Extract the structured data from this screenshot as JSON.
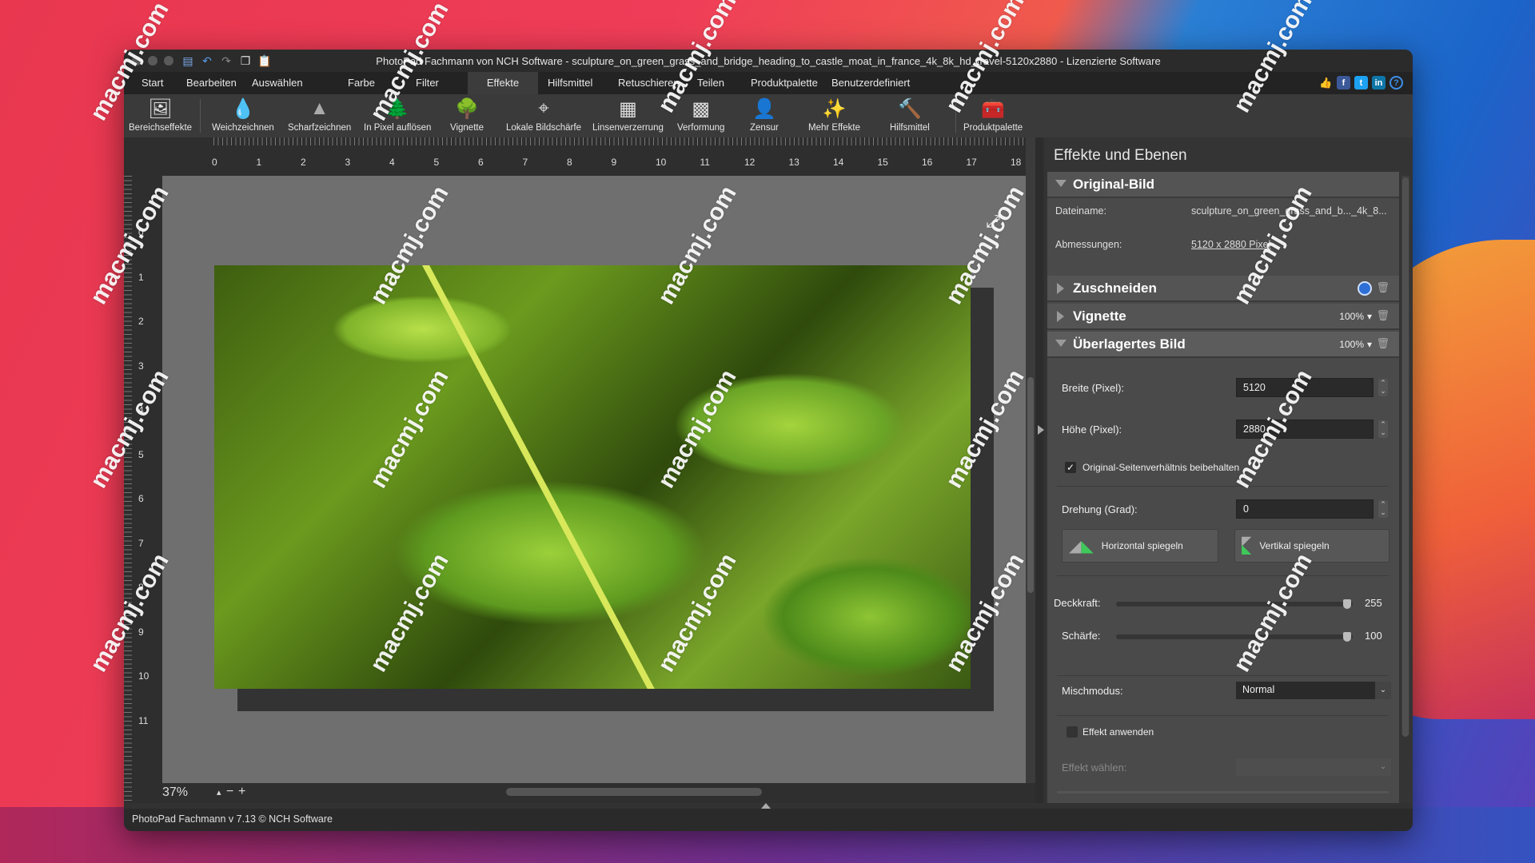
{
  "window": {
    "title": "PhotoPad Fachmann von NCH Software - sculpture_on_green_grass_and_bridge_heading_to_castle_moat_in_france_4k_8k_hd_travel-5120x2880 - Lizenzierte Software"
  },
  "quick_access": [
    "save-icon",
    "undo-icon",
    "redo-icon",
    "copy-icon",
    "paste-icon"
  ],
  "menu": {
    "items": [
      "Start",
      "Bearbeiten",
      "Auswählen",
      "Farbe",
      "Filter",
      "Effekte",
      "Hilfsmittel",
      "Retuschieren",
      "Teilen",
      "Produktpalette",
      "Benutzerdefiniert"
    ],
    "active": "Effekte"
  },
  "social": {
    "like": "👍",
    "facebook": "f",
    "twitter": "t",
    "linkedin": "in",
    "help": "?"
  },
  "toolbar": {
    "tools": [
      {
        "label": "Bereichseffekte",
        "icon": "area-effects-icon",
        "glyph": "🖼"
      },
      {
        "label": "Weichzeichnen",
        "icon": "blur-drop-icon",
        "glyph": "💧"
      },
      {
        "label": "Scharfzeichnen",
        "icon": "sharpen-triangle-icon",
        "glyph": "▲"
      },
      {
        "label": "In Pixel auflösen",
        "icon": "pixelate-icon",
        "glyph": "🌲"
      },
      {
        "label": "Vignette",
        "icon": "vignette-icon",
        "glyph": "🌳"
      },
      {
        "label": "Lokale Bildschärfe",
        "icon": "focus-target-icon",
        "glyph": "⌖"
      },
      {
        "label": "Linsenverzerrung",
        "icon": "lens-grid-icon",
        "glyph": "▦"
      },
      {
        "label": "Verformung",
        "icon": "warp-grid-icon",
        "glyph": "▩"
      },
      {
        "label": "Zensur",
        "icon": "censor-person-icon",
        "glyph": "👤"
      },
      {
        "label": "Mehr Effekte",
        "icon": "more-effects-icon",
        "glyph": "✨"
      },
      {
        "label": "Hilfsmittel",
        "icon": "tools-hammer-icon",
        "glyph": "🔨"
      },
      {
        "label": "Produktpalette",
        "icon": "product-palette-icon",
        "glyph": "🧰"
      }
    ]
  },
  "ruler": {
    "horizontal": [
      "0",
      "1",
      "2",
      "3",
      "4",
      "5",
      "6",
      "7",
      "8",
      "9",
      "10",
      "11",
      "12",
      "13",
      "14",
      "15",
      "16",
      "17",
      "18"
    ],
    "vertical": [
      "0",
      "1",
      "2",
      "3",
      "4",
      "5",
      "6",
      "7",
      "8",
      "9",
      "10",
      "11"
    ]
  },
  "canvas": {
    "zoom": "37%",
    "zoom_step_up": "▴",
    "zoom_out": "−",
    "zoom_in": "+",
    "fullscreen_glyph": "⤢"
  },
  "status": {
    "text": "PhotoPad Fachmann v 7.13 © NCH Software"
  },
  "panel": {
    "title": "Effekte und Ebenen",
    "original": {
      "heading": "Original-Bild",
      "filename_label": "Dateiname:",
      "filename_value": "sculpture_on_green_grass_and_b..._4k_8...",
      "dimensions_label": "Abmessungen:",
      "dimensions_value": "5120 x 2880 Pixel"
    },
    "layers": [
      {
        "name": "Zuschneiden",
        "percent": "",
        "enabled": true
      },
      {
        "name": "Vignette",
        "percent": "100%",
        "enabled": false
      },
      {
        "name": "Überlagertes Bild",
        "percent": "100%",
        "enabled": false
      }
    ],
    "overlay": {
      "width_label": "Breite (Pixel):",
      "width_value": "5120",
      "height_label": "Höhe (Pixel):",
      "height_value": "2880",
      "keep_ratio_label": "Original-Seitenverhältnis beibehalten",
      "keep_ratio_checked": true,
      "rotation_label": "Drehung (Grad):",
      "rotation_value": "0",
      "flip_h_label": "Horizontal spiegeln",
      "flip_v_label": "Vertikal spiegeln",
      "opacity_label": "Deckkraft:",
      "opacity_value": "255",
      "opacity_fraction": 1.0,
      "sharpness_label": "Schärfe:",
      "sharpness_value": "100",
      "sharpness_fraction": 1.0,
      "blend_label": "Mischmodus:",
      "blend_value": "Normal",
      "apply_effect_label": "Effekt anwenden",
      "apply_effect_checked": false,
      "choose_effect_label": "Effekt wählen:",
      "choose_effect_value": ""
    }
  },
  "watermark": "macmj.com",
  "colors": {
    "accent_blue": "#2d6fd6",
    "active_tab": "#3c3c3c",
    "panel": "#4a4a4a"
  }
}
